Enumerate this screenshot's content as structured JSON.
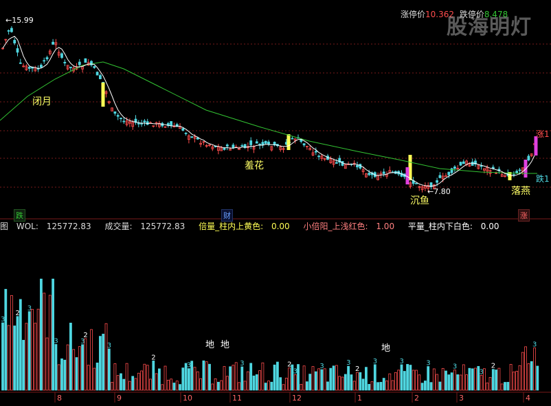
{
  "colors": {
    "background": "#000000",
    "up": "#ff4d4d",
    "down": "#4fd6e0",
    "yellow": "#ffff55",
    "magenta": "#e040e0",
    "ma_long": "#33c433",
    "ma_short": "#ffffff",
    "grid": "#7a1a1a"
  },
  "top_right": {
    "limit_up_label": "涨停价",
    "limit_up_value": "10.362",
    "limit_down_label": "跌停价",
    "limit_down_value": "8.478"
  },
  "watermark": "股海明灯",
  "price_panel": {
    "high_label": "15.99",
    "low_label": "7.80",
    "annotations": [
      "闭月",
      "羞花",
      "沉鱼",
      "落燕",
      "涨1",
      "跌1"
    ],
    "signals": {
      "left": "跌",
      "middle": "财",
      "right": "涨"
    }
  },
  "volume_header": {
    "prefix": "图",
    "items": [
      {
        "label": "WOL:",
        "value": "125772.83"
      },
      {
        "label": "成交量:",
        "value": "125772.83"
      },
      {
        "label": "倍量_柱内上黄色:",
        "value": "0.00"
      },
      {
        "label": "小倍阳_上浅红色:",
        "value": "1.00"
      },
      {
        "label": "平量_柱内下白色:",
        "value": "0.00"
      }
    ]
  },
  "volume_panel": {
    "ground_labels": [
      "地",
      "地",
      "地"
    ]
  },
  "chart_data": {
    "type": "candlestick",
    "months": [
      "8",
      "9",
      "10",
      "11",
      "12",
      "1",
      "2",
      "3",
      "4"
    ],
    "price_high": 15.99,
    "price_low": 7.8,
    "volume_markers": [
      "3",
      "2"
    ]
  }
}
